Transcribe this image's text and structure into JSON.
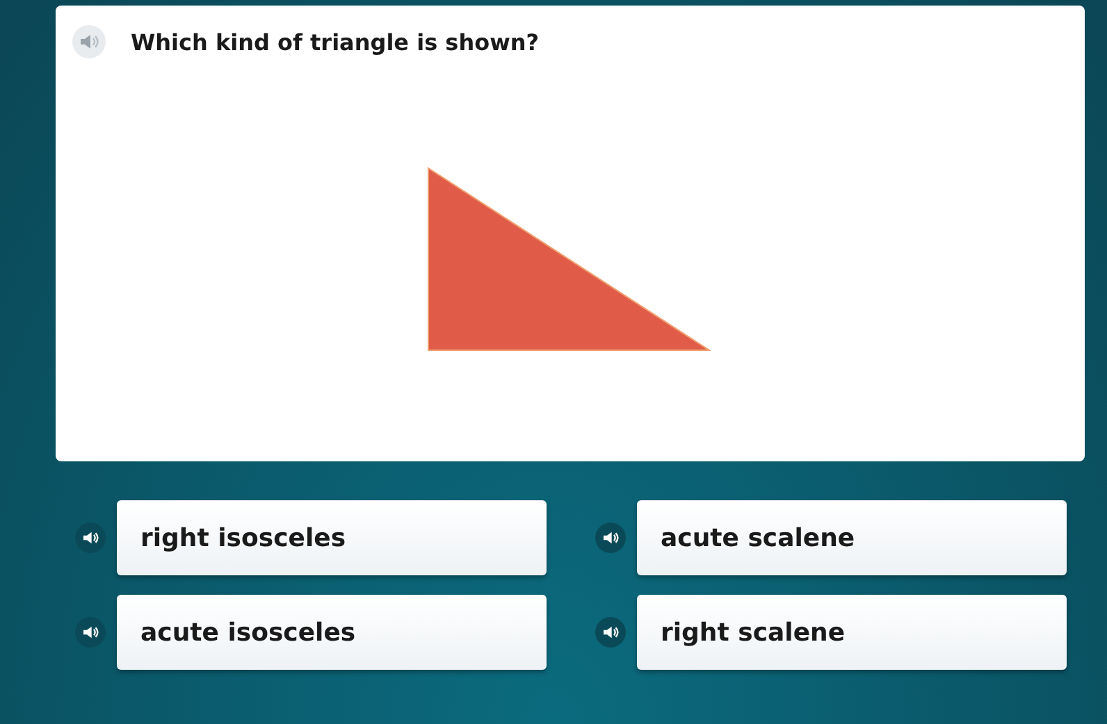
{
  "question": {
    "text": "Which kind of triangle is shown?",
    "figure": {
      "kind": "right-triangle",
      "color": "#e05c48"
    }
  },
  "answers": [
    {
      "label": "right isosceles"
    },
    {
      "label": "acute scalene"
    },
    {
      "label": "acute isosceles"
    },
    {
      "label": "right scalene"
    }
  ]
}
